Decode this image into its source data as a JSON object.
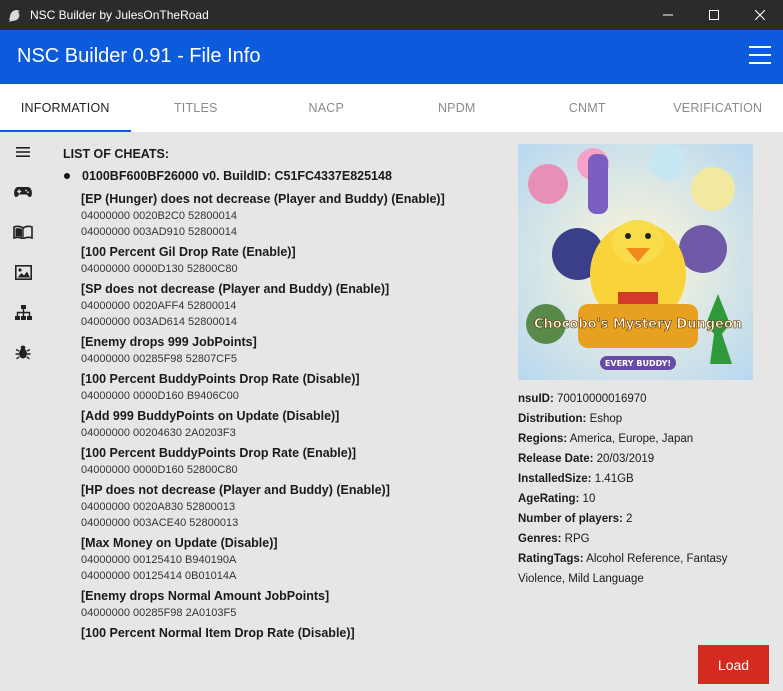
{
  "window": {
    "title": "NSC Builder by JulesOnTheRoad",
    "app_icon": "bird-icon",
    "controls": [
      "minimize-icon",
      "maximize-icon",
      "close-icon"
    ]
  },
  "appbar": {
    "title": "NSC Builder 0.91 - File Info",
    "menu_icon": "hamburger-icon"
  },
  "tabs": [
    "INFORMATION",
    "TITLES",
    "NACP",
    "NPDM",
    "CNMT",
    "VERIFICATION"
  ],
  "active_tab": "INFORMATION",
  "rail": [
    "list-icon",
    "gamepad-icon",
    "book-icon",
    "image-icon",
    "sitemap-icon",
    "bug-icon"
  ],
  "cheats": {
    "heading": "LIST OF CHEATS:",
    "game": "0100BF600BF26000 v0. BuildID: C51FC4337E825148",
    "items": [
      {
        "name": "[EP (Hunger) does not decrease (Player and Buddy) (Enable)]",
        "codes": [
          "04000000 0020B2C0 52800014",
          "04000000 003AD910 52800014"
        ]
      },
      {
        "name": "[100 Percent Gil Drop Rate (Enable)]",
        "codes": [
          "04000000 0000D130 52800C80"
        ]
      },
      {
        "name": "[SP does not decrease (Player and Buddy) (Enable)]",
        "codes": [
          "04000000 0020AFF4 52800014",
          "04000000 003AD614 52800014"
        ]
      },
      {
        "name": "[Enemy drops 999 JobPoints]",
        "codes": [
          "04000000 00285F98 52807CF5"
        ]
      },
      {
        "name": "[100 Percent BuddyPoints Drop Rate (Disable)]",
        "codes": [
          "04000000 0000D160 B9406C00"
        ]
      },
      {
        "name": "[Add 999 BuddyPoints on Update (Disable)]",
        "codes": [
          "04000000 00204630 2A0203F3"
        ]
      },
      {
        "name": "[100 Percent BuddyPoints Drop Rate (Enable)]",
        "codes": [
          "04000000 0000D160 52800C80"
        ]
      },
      {
        "name": "[HP does not decrease (Player and Buddy) (Enable)]",
        "codes": [
          "04000000 0020A830 52800013",
          "04000000 003ACE40 52800013"
        ]
      },
      {
        "name": "[Max Money on Update (Disable)]",
        "codes": [
          "04000000 00125410 B940190A",
          "04000000 00125414 0B01014A"
        ]
      },
      {
        "name": "[Enemy drops Normal Amount JobPoints]",
        "codes": [
          "04000000 00285F98 2A0103F5"
        ]
      },
      {
        "name": "[100 Percent Normal Item Drop Rate (Disable)]",
        "codes": []
      }
    ]
  },
  "cover": {
    "logo_text": "Chocobo's Mystery Dungeon",
    "logo_sub": "EVERY BUDDY!"
  },
  "info": [
    {
      "label": "nsuID:",
      "value": "70010000016970"
    },
    {
      "label": "Distribution:",
      "value": "Eshop"
    },
    {
      "label": "Regions:",
      "value": "America, Europe, Japan"
    },
    {
      "label": "Release Date:",
      "value": "20/03/2019"
    },
    {
      "label": "InstalledSize:",
      "value": "1.41GB"
    },
    {
      "label": "AgeRating:",
      "value": "10"
    },
    {
      "label": "Number of players:",
      "value": "2"
    },
    {
      "label": "Genres:",
      "value": "RPG"
    },
    {
      "label": "RatingTags:",
      "value": "Alcohol Reference, Fantasy Violence, Mild Language"
    }
  ],
  "load_button": "Load",
  "colors": {
    "accent": "#0d5bdd",
    "titlebar": "#2b2b2b",
    "load": "#d42a1f"
  }
}
